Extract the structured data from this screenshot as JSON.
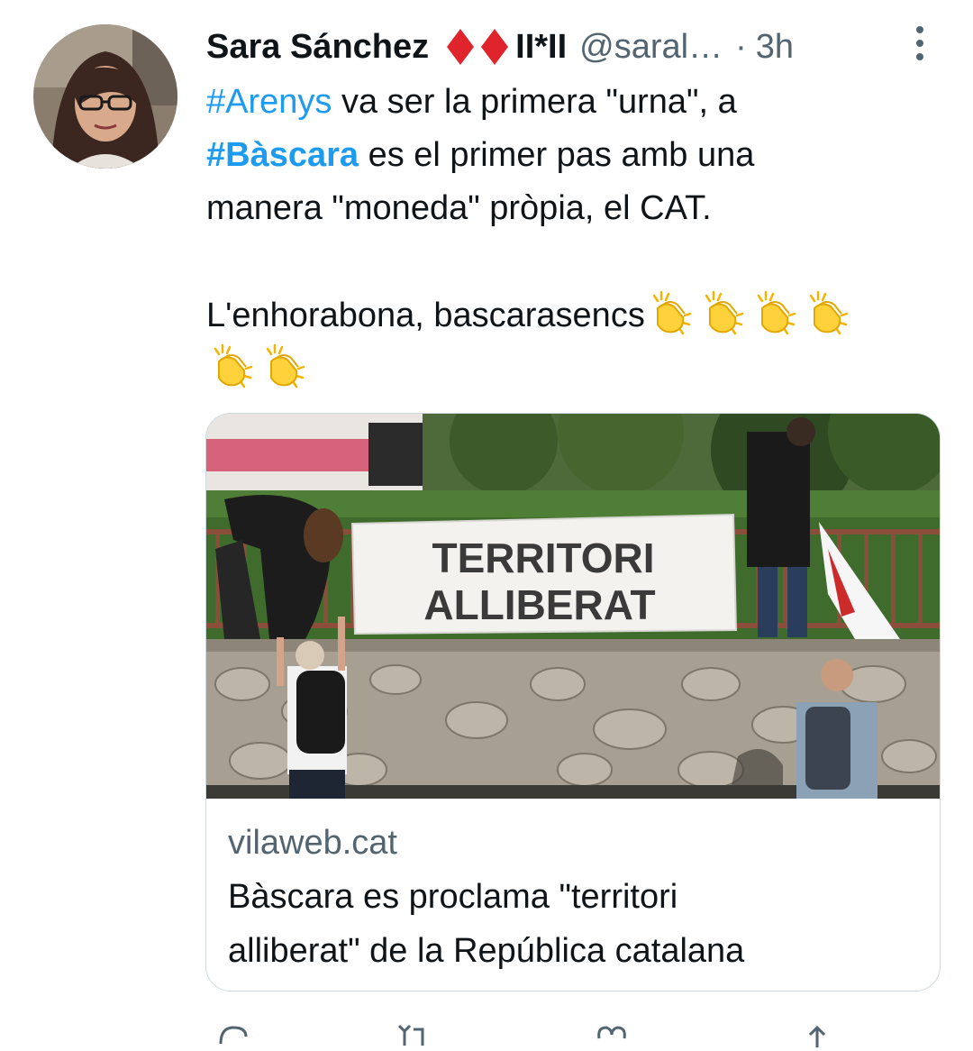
{
  "tweet": {
    "author_name": "Sara Sánchez",
    "flag_text": "II*II",
    "handle": "@saral…",
    "separator": "·",
    "time": "3h",
    "lines": {
      "l1_tag": "#Arenys",
      "l1_rest": " va ser la primera \"urna\", a",
      "l2_tag": "#Bàscara",
      "l2_rest": " es el primer pas amb una",
      "l3": "manera \"moneda\" pròpia, el CAT.",
      "l4": "L'enhorabona, bascarasencs"
    },
    "emoji_name": "clapping-hands",
    "emoji_count": 6
  },
  "card": {
    "banner_text_line1": "TERRITORI",
    "banner_text_line2": "ALLIBERAT",
    "domain": "vilaweb.cat",
    "title_line1": "Bàscara es proclama \"territori",
    "title_line2": "alliberat\" de la República catalana"
  },
  "actions": {
    "icons": [
      "reply-icon",
      "retweet-icon",
      "like-icon",
      "share-icon"
    ]
  },
  "colors": {
    "link": "#1d9bf0",
    "secondary": "#536471",
    "diamond": "#e0242c"
  }
}
